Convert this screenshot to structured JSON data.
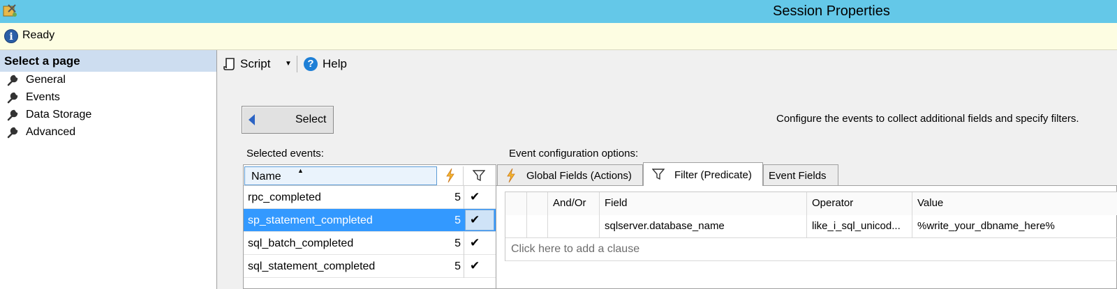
{
  "window": {
    "title": "Session Properties"
  },
  "status": {
    "text": "Ready",
    "icon": "info-icon"
  },
  "sidebar": {
    "header": "Select a page",
    "items": [
      {
        "label": "General",
        "icon": "wrench-icon"
      },
      {
        "label": "Events",
        "icon": "wrench-icon"
      },
      {
        "label": "Data Storage",
        "icon": "wrench-icon"
      },
      {
        "label": "Advanced",
        "icon": "wrench-icon"
      }
    ]
  },
  "toolbar": {
    "script_label": "Script",
    "help_label": "Help"
  },
  "main": {
    "select_button_label": "Select",
    "description": "Configure the events to collect additional fields and specify filters.",
    "selected_events_label": "Selected events:",
    "event_config_label": "Event configuration options:"
  },
  "events_grid": {
    "columns": {
      "name": "Name",
      "actions_icon": "lightning-bolt-icon",
      "filter_icon": "funnel-icon"
    },
    "rows": [
      {
        "name": "rpc_completed",
        "count": "5",
        "filter": "✔",
        "selected": false
      },
      {
        "name": "sp_statement_completed",
        "count": "5",
        "filter": "✔",
        "selected": true
      },
      {
        "name": "sql_batch_completed",
        "count": "5",
        "filter": "✔",
        "selected": false
      },
      {
        "name": "sql_statement_completed",
        "count": "5",
        "filter": "✔",
        "selected": false
      }
    ]
  },
  "tabs": [
    {
      "label": "Global Fields (Actions)",
      "icon": "lightning-bolt-icon",
      "active": false
    },
    {
      "label": "Filter (Predicate)",
      "icon": "funnel-icon",
      "active": true
    },
    {
      "label": "Event Fields",
      "active": false
    }
  ],
  "filter_grid": {
    "headers": {
      "and_or": "And/Or",
      "field": "Field",
      "operator": "Operator",
      "value": "Value"
    },
    "rows": [
      {
        "and_or": "",
        "field": "sqlserver.database_name",
        "operator": "like_i_sql_unicod...",
        "value": "%write_your_dbname_here%"
      }
    ],
    "add_clause": "Click here to add a clause"
  },
  "colors": {
    "titlebar": "#64c8e8",
    "statusbar": "#fdfde2",
    "selection": "#3399ff",
    "sidebar_header": "#cdddf0"
  }
}
